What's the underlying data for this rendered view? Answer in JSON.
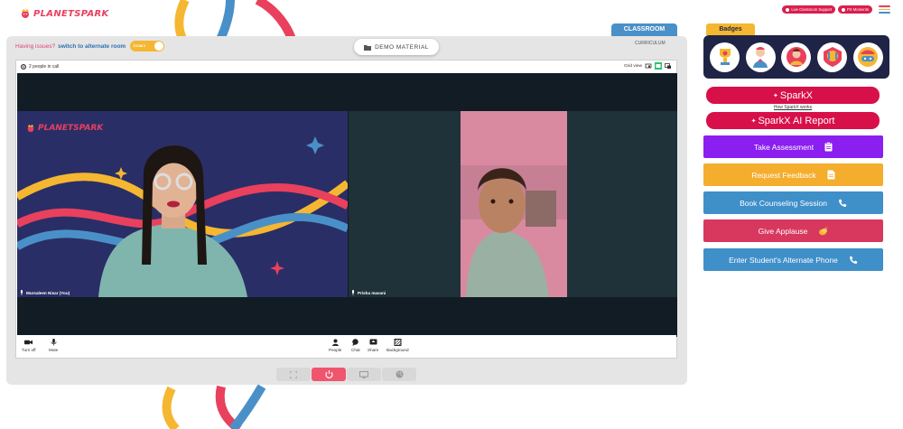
{
  "header": {
    "logo_text": "PLANETSPARK",
    "live_support_label": "Live Classroom Support",
    "ps_moments_label": "PS Moments"
  },
  "classroom": {
    "tab_label": "CLASSROOM",
    "curriculum_label": "CURRICULUM",
    "issues_text": "Having issues?",
    "switch_text": "switch to alternate room",
    "toggle_label": "ZOOM 2",
    "demo_material_label": "DEMO MATERIAL"
  },
  "call": {
    "people_count": "2 people in call",
    "grid_view_label": "Grid view",
    "participants": [
      {
        "name": "Mursaleen Nisar (You)"
      },
      {
        "name": "Prisha mavani"
      }
    ],
    "toolbar": {
      "camera_label": "Turn off",
      "mic_label": "Mute",
      "people_label": "People",
      "chat_label": "Chat",
      "share_label": "Share",
      "background_label": "Background"
    },
    "tile_logo_text": "PLANETSPARK"
  },
  "sidebar": {
    "badges_label": "Badges",
    "badges": [
      "trophy-badge-icon",
      "hero-badge-icon",
      "superstar-badge-icon",
      "champion-badge-icon",
      "gamer-badge-icon"
    ],
    "sparkx_label": "SparkX",
    "how_sparkx_label": "How SparkX works",
    "sparkx_report_label": "SparkX AI Report",
    "actions": [
      {
        "label": "Take Assessment",
        "color": "#8a1ff0",
        "icon": "clipboard-icon"
      },
      {
        "label": "Request Feedback",
        "color": "#f4ad2d",
        "icon": "document-icon"
      },
      {
        "label": "Book Counseling Session",
        "color": "#3f8fc9",
        "icon": "phone-icon"
      },
      {
        "label": "Give Applause",
        "color": "#d8375e",
        "icon": "clap-icon"
      },
      {
        "label": "Enter Student's Alternate Phone",
        "color": "#3f8fc9",
        "icon": "phone-icon"
      }
    ]
  },
  "colors": {
    "brand_red": "#e9405e",
    "navy": "#1f2446",
    "yellow": "#f5b731",
    "blue": "#4a90c8",
    "end_call_red": "#f0556e"
  }
}
